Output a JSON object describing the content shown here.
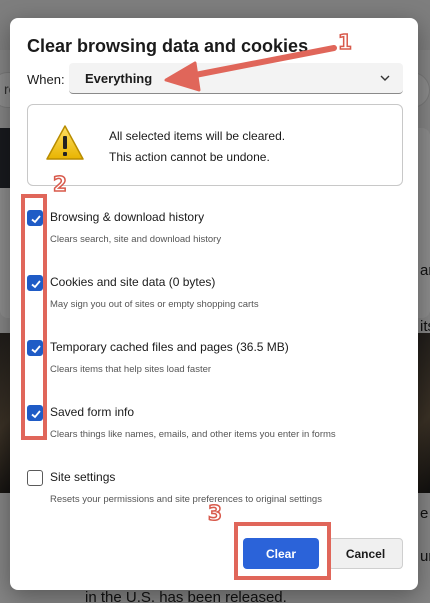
{
  "background": {
    "search_partial": "ro",
    "bottom_text": "in the U.S. has been released.",
    "right_partial_1": "ar",
    "right_partial_2": "itsel",
    "right_partial_3": "e",
    "right_partial_4": "ur"
  },
  "dialog": {
    "title": "Clear browsing data and cookies",
    "when": {
      "label": "When:",
      "value": "Everything"
    },
    "warning": {
      "line1": "All selected items will be cleared.",
      "line2": "This action cannot be undone."
    },
    "options": [
      {
        "label": "Browsing & download history",
        "description": "Clears search, site and download history",
        "checked": true
      },
      {
        "label": "Cookies and site data (0 bytes)",
        "description": "May sign you out of sites or empty shopping carts",
        "checked": true
      },
      {
        "label": "Temporary cached files and pages (36.5 MB)",
        "description": "Clears items that help sites load faster",
        "checked": true
      },
      {
        "label": "Saved form info",
        "description": "Clears things like names, emails, and other items you enter in forms",
        "checked": true
      },
      {
        "label": "Site settings",
        "description": "Resets your permissions and site preferences to original settings",
        "checked": false
      }
    ],
    "buttons": {
      "clear": "Clear",
      "cancel": "Cancel"
    }
  },
  "annotations": {
    "step1": "1",
    "step2": "2",
    "step3": "3",
    "color": "#e0665a"
  }
}
